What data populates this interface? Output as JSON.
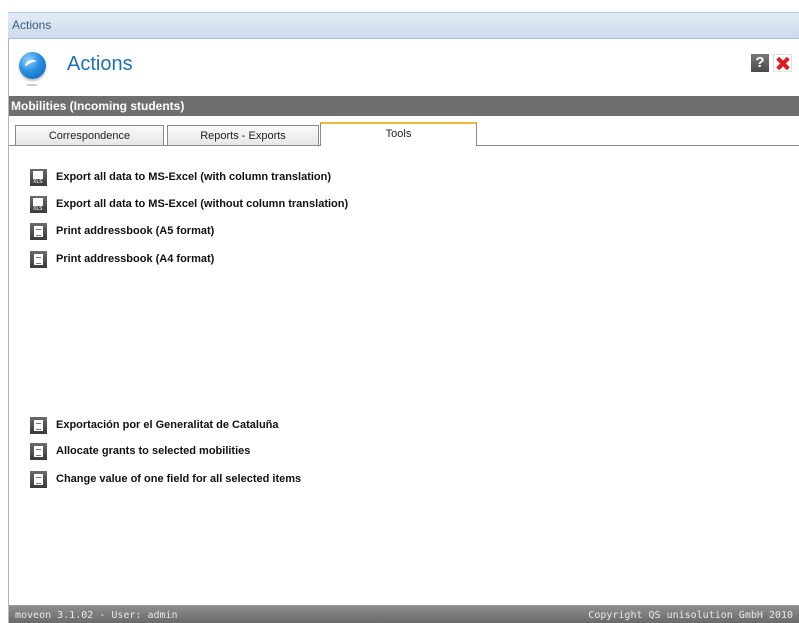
{
  "window": {
    "title": "Actions"
  },
  "header": {
    "title": "Actions",
    "help_label": "?"
  },
  "section": {
    "title": "Mobilities (Incoming students)"
  },
  "tabs": [
    {
      "label": "Correspondence",
      "active": false
    },
    {
      "label": "Reports - Exports",
      "active": false
    },
    {
      "label": "Tools",
      "active": true
    }
  ],
  "actions_top": [
    {
      "label": "Export all data to MS-Excel (with column translation)",
      "icon": "excel-export-icon",
      "icon_text": "XLS"
    },
    {
      "label": "Export all data to MS-Excel (without column translation)",
      "icon": "excel-export-icon",
      "icon_text": "XLS"
    },
    {
      "label": "Print addressbook (A5 format)",
      "icon": "document-icon"
    },
    {
      "label": "Print addressbook (A4 format)",
      "icon": "document-icon"
    }
  ],
  "actions_bottom": [
    {
      "label": "Exportación por el Generalitat de Cataluña",
      "icon": "document-icon"
    },
    {
      "label": "Allocate grants to selected mobilities",
      "icon": "document-icon"
    },
    {
      "label": "Change value of one field for all selected items",
      "icon": "document-icon"
    }
  ],
  "status": {
    "left": "moveon 3.1.02 - User: admin",
    "right": "Copyright QS unisolution GmbH 2010"
  },
  "colors": {
    "accent": "#1e6fb8",
    "section_bar": "#6f6f6f",
    "active_tab_highlight": "#f4b63c",
    "close_red": "#e11b1b"
  }
}
